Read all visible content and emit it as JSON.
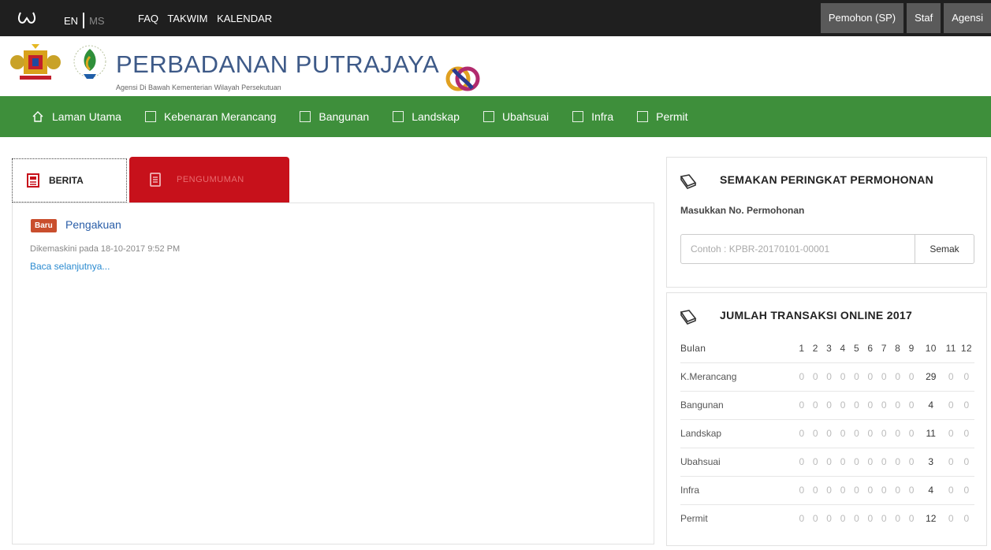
{
  "topbar": {
    "lang_en": "EN",
    "lang_ms": "MS",
    "links": [
      "FAQ",
      "TAKWIM",
      "KALENDAR"
    ],
    "right_buttons": [
      "Pemohon (SP)",
      "Staf",
      "Agensi"
    ]
  },
  "header": {
    "brand": "PERBADANAN PUTRAJAYA",
    "tagline": "Agensi Di Bawah Kementerian Wilayah Persekutuan"
  },
  "nav": {
    "items": [
      "Laman Utama",
      "Kebenaran Merancang",
      "Bangunan",
      "Landskap",
      "Ubahsuai",
      "Infra",
      "Permit"
    ]
  },
  "tabs": {
    "berita": "BERITA",
    "pengumuman": "PENGUMUMAN"
  },
  "news": {
    "badge": "Baru",
    "title": "Pengakuan",
    "date": "Dikemaskini pada 18-10-2017 9:52 PM",
    "more": "Baca selanjutnya..."
  },
  "semakan": {
    "title": "SEMAKAN PERINGKAT PERMOHONAN",
    "label": "Masukkan No. Permohonan",
    "placeholder": "Contoh : KPBR-20170101-00001",
    "button": "Semak"
  },
  "transaksi": {
    "title": "JUMLAH TRANSAKSI ONLINE 2017",
    "header_label": "Bulan",
    "months": [
      "1",
      "2",
      "3",
      "4",
      "5",
      "6",
      "7",
      "8",
      "9",
      "10",
      "11",
      "12"
    ],
    "rows": [
      {
        "label": "K.Merancang",
        "values": [
          "0",
          "0",
          "0",
          "0",
          "0",
          "0",
          "0",
          "0",
          "0",
          "29",
          "0",
          "0"
        ]
      },
      {
        "label": "Bangunan",
        "values": [
          "0",
          "0",
          "0",
          "0",
          "0",
          "0",
          "0",
          "0",
          "0",
          "4",
          "0",
          "0"
        ]
      },
      {
        "label": "Landskap",
        "values": [
          "0",
          "0",
          "0",
          "0",
          "0",
          "0",
          "0",
          "0",
          "0",
          "11",
          "0",
          "0"
        ]
      },
      {
        "label": "Ubahsuai",
        "values": [
          "0",
          "0",
          "0",
          "0",
          "0",
          "0",
          "0",
          "0",
          "0",
          "3",
          "0",
          "0"
        ]
      },
      {
        "label": "Infra",
        "values": [
          "0",
          "0",
          "0",
          "0",
          "0",
          "0",
          "0",
          "0",
          "0",
          "4",
          "0",
          "0"
        ]
      },
      {
        "label": "Permit",
        "values": [
          "0",
          "0",
          "0",
          "0",
          "0",
          "0",
          "0",
          "0",
          "0",
          "12",
          "0",
          "0"
        ]
      }
    ]
  },
  "colors": {
    "topbar": "#1f1f1f",
    "nav": "#3e8f3b",
    "tab_active": "#c7111b",
    "badge": "#c94e2d",
    "link": "#2a5ea8"
  }
}
